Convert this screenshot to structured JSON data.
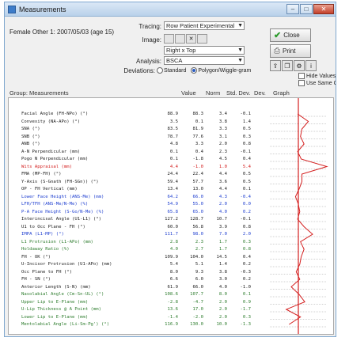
{
  "window": {
    "title": "Measurements",
    "min": "–",
    "max": "□",
    "close": "✕"
  },
  "patient_label": "Female Other 1: 2007/05/03 (age 15)",
  "controls": {
    "tracings_label": "Tracing:",
    "tracing_value": "Row Patient Experimental",
    "image_label": "Image:",
    "image_btns": [
      "",
      "",
      "",
      ""
    ],
    "view_label": "",
    "view_value": "Right x Top",
    "analysis_label": "Analysis:",
    "analysis_value": "BSCA",
    "dev_label": "Deviations:",
    "radio_standard": "Standard",
    "radio_polygon": "Polygon/Wiggle-gram",
    "close_btn": "Close",
    "print_btn": "Print",
    "hide_values": "Hide Values",
    "same_color": "Use Same Color"
  },
  "columns": {
    "group": "Group: Measurements",
    "value": "Value",
    "norm": "Norm",
    "std": "Std. Dev.",
    "dev": "Dev.",
    "graph": "Graph"
  },
  "rows": [
    {
      "name": "Facial Angle (FH-NPo) (°)",
      "v": "88.9",
      "n": "88.3",
      "s": "3.4",
      "d": "-0.1",
      "color": "black"
    },
    {
      "name": "Convexity (NA-APo) (°)",
      "v": "3.5",
      "n": "0.1",
      "s": "3.8",
      "d": "1.4",
      "color": "black"
    },
    {
      "name": "SNA (°)",
      "v": "83.5",
      "n": "81.9",
      "s": "3.3",
      "d": "0.5",
      "color": "black"
    },
    {
      "name": "SNB (°)",
      "v": "78.7",
      "n": "77.6",
      "s": "3.1",
      "d": "0.3",
      "color": "black"
    },
    {
      "name": "ANB (°)",
      "v": "4.8",
      "n": "3.3",
      "s": "2.0",
      "d": "0.8",
      "color": "black"
    },
    {
      "name": "A-N Perpendicular (mm)",
      "v": "0.1",
      "n": "0.4",
      "s": "2.3",
      "d": "-0.1",
      "color": "black"
    },
    {
      "name": "Pogo N Perpendicular (mm)",
      "v": "0.1",
      "n": "-1.8",
      "s": "4.5",
      "d": "0.4",
      "color": "black"
    },
    {
      "name": "Wits Appraisal (mm)",
      "v": "4.4",
      "n": "-1.0",
      "s": "1.0",
      "d": "5.4",
      "color": "red"
    },
    {
      "name": "FMA (MP-FH) (°)",
      "v": "24.4",
      "n": "22.4",
      "s": "4.4",
      "d": "0.5",
      "color": "black"
    },
    {
      "name": "Y-Axis (S-Gnath (FH-SGn)) (°)",
      "v": "59.4",
      "n": "57.7",
      "s": "3.6",
      "d": "0.5",
      "color": "black"
    },
    {
      "name": "OP - FH Vertical (mm)",
      "v": "13.4",
      "n": "13.0",
      "s": "4.4",
      "d": "0.1",
      "color": "black"
    },
    {
      "name": "Lower Face Height (ANS-Me) (mm)",
      "v": "64.2",
      "n": "66.0",
      "s": "4.3",
      "d": "-0.4",
      "color": "blue"
    },
    {
      "name": "LFH/TFH (ANS-Me/N-Me) (%)",
      "v": "54.9",
      "n": "55.0",
      "s": "2.0",
      "d": "0.0",
      "color": "blue"
    },
    {
      "name": "P-A Face Height (S-Go/N-Me) (%)",
      "v": "65.8",
      "n": "65.0",
      "s": "4.0",
      "d": "0.2",
      "color": "blue"
    },
    {
      "name": "Interincisal Angle (U1-L1) (°)",
      "v": "127.2",
      "n": "128.7",
      "s": "10.7",
      "d": "-0.1",
      "color": "black"
    },
    {
      "name": "U1 to Occ Plane - FH (°)",
      "v": "60.0",
      "n": "56.8",
      "s": "3.9",
      "d": "0.8",
      "color": "black"
    },
    {
      "name": "IMPA (L1-MP) (°)",
      "v": "111.7",
      "n": "98.0",
      "s": "7.0",
      "d": "2.0",
      "color": "blue"
    },
    {
      "name": "L1 Protrusion (L1-APo) (mm)",
      "v": "2.8",
      "n": "2.3",
      "s": "1.7",
      "d": "0.3",
      "color": "green"
    },
    {
      "name": "Holdaway Ratio (%)",
      "v": "4.0",
      "n": "2.7",
      "s": "1.7",
      "d": "0.8",
      "color": "green"
    },
    {
      "name": "FH - OK (°)",
      "v": "109.9",
      "n": "104.0",
      "s": "14.5",
      "d": "0.4",
      "color": "black"
    },
    {
      "name": "U-Incisor Protrusion (U1-APo) (mm)",
      "v": "5.4",
      "n": "5.1",
      "s": "1.4",
      "d": "0.2",
      "color": "black"
    },
    {
      "name": "Occ Plane to FH (°)",
      "v": "8.0",
      "n": "9.3",
      "s": "3.8",
      "d": "-0.3",
      "color": "black"
    },
    {
      "name": "FH - SN (°)",
      "v": "6.6",
      "n": "6.0",
      "s": "3.0",
      "d": "0.2",
      "color": "black"
    },
    {
      "name": "Anterior Length (S-N) (mm)",
      "v": "61.9",
      "n": "66.0",
      "s": "4.0",
      "d": "-1.0",
      "color": "black"
    },
    {
      "name": "Nasolabial Angle (Cm-Sn-UL) (°)",
      "v": "108.6",
      "n": "107.7",
      "s": "8.0",
      "d": "0.1",
      "color": "green"
    },
    {
      "name": "Upper Lip to E-Plane (mm)",
      "v": "-2.8",
      "n": "-4.7",
      "s": "2.0",
      "d": "0.9",
      "color": "green"
    },
    {
      "name": "U-Lip Thickness @ A Point (mm)",
      "v": "13.6",
      "n": "17.0",
      "s": "2.0",
      "d": "-1.7",
      "color": "green"
    },
    {
      "name": "Lower Lip to E-Plane (mm)",
      "v": "-1.4",
      "n": "-2.0",
      "s": "2.0",
      "d": "0.3",
      "color": "green"
    },
    {
      "name": "Mentolabial Angle (Li-Sm-Pg') (°)",
      "v": "116.9",
      "n": "130.0",
      "s": "10.0",
      "d": "-1.3",
      "color": "green"
    }
  ]
}
